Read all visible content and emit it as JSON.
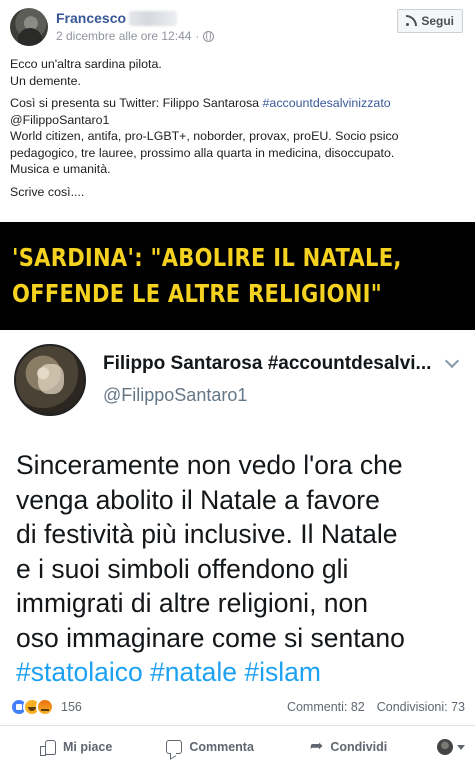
{
  "header": {
    "author_name": "Francesco",
    "timestamp": "2 dicembre alle ore 12:44",
    "meta_separator": "·",
    "follow_label": "Segui"
  },
  "post": {
    "line1": "Ecco un'altra sardina pilota.",
    "line2": "Un demente.",
    "line3_prefix": "Così si presenta su Twitter: Filippo Santarosa ",
    "line3_hashtag": "#accountdesalvinizzato",
    "line4": "@FilippoSantaro1",
    "line5": "World citizen, antifa, pro-LGBT+, noborder, provax, proEU. Socio psico",
    "line6": "pedagogico, tre lauree, prossimo alla quarta in medicina, disoccupato.",
    "line7": "Musica e umanità.",
    "line8": "Scrive così...."
  },
  "image": {
    "headline_line1": "'SARDINA': \"ABOLIRE IL NATALE,",
    "headline_line2": "OFFENDE LE ALTRE RELIGIONI\"",
    "tweet": {
      "name": "Filippo Santarosa #accountdesalvi...",
      "handle": "@FilippoSantaro1",
      "body_lines": [
        "Sinceramente non vedo l'ora che",
        "venga abolito il Natale a favore",
        "di festività più inclusive. Il Natale",
        "e i suoi simboli offendono gli",
        "immigrati di altre religioni, non",
        "oso immaginare come si sentano"
      ],
      "hashtags": "#statolaico #natale #islam"
    }
  },
  "reactions": {
    "count": "156",
    "comments": "Commenti: 82",
    "shares": "Condivisioni: 73",
    "icons": [
      "like-icon",
      "haha-icon",
      "angry-icon"
    ]
  },
  "actions": {
    "like_label": "Mi piace",
    "comment_label": "Commenta",
    "share_label": "Condividi"
  }
}
